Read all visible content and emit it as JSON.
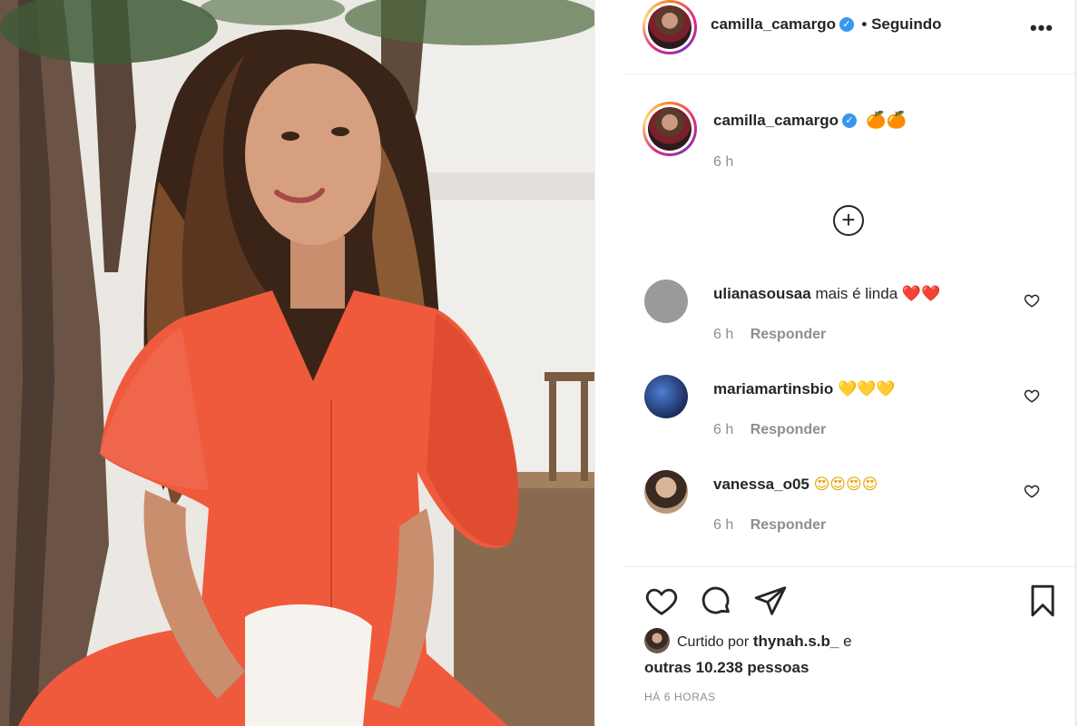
{
  "post": {
    "author": "camilla_camargo",
    "follow_status": "• Seguindo",
    "more_label": "•••",
    "caption_emojis": "🍊🍊",
    "caption_time": "6 h",
    "add_label": "+"
  },
  "comments": [
    {
      "user": "ulianasousaa",
      "text": "mais é linda",
      "emojis": "❤️❤️",
      "time": "6 h",
      "reply": "Responder",
      "avatar_color": "#9a9a9a"
    },
    {
      "user": "mariamartinsbio",
      "text": "",
      "emojis": "💛💛💛",
      "time": "6 h",
      "reply": "Responder",
      "avatar_color": "#243a73"
    },
    {
      "user": "vanessa_o05",
      "text": "",
      "emojis": "😍😍😍😍",
      "time": "6 h",
      "reply": "Responder",
      "avatar_color": "#b99a7c"
    }
  ],
  "likes": {
    "prefix": "Curtido por",
    "first_liker": "thynah.s.b_",
    "conj": "e",
    "others": "outras 10.238 pessoas"
  },
  "time_ago": "HÁ 6 HORAS",
  "icons": [
    "heart-icon",
    "comment-icon",
    "share-icon",
    "bookmark-icon",
    "verified-icon",
    "plus-circle-icon"
  ],
  "colors": {
    "verified": "#3897f0",
    "muted": "#8e8e8e",
    "text": "#262626",
    "dress": "#ef5a3c"
  }
}
